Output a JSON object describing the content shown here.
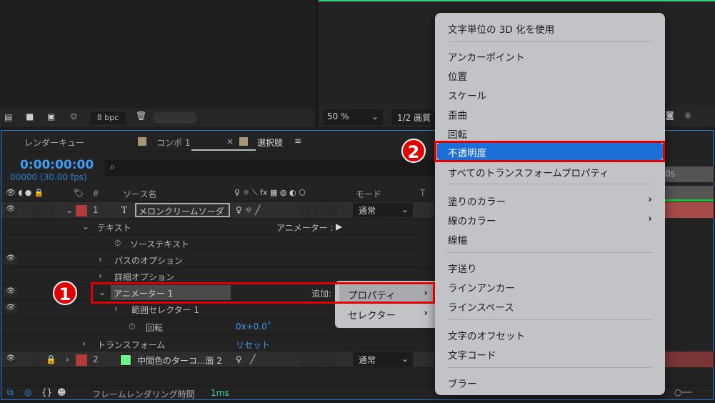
{
  "viewer_bar": {
    "bpc": "8 bpc",
    "zoom": "50 %",
    "quality": "1/2 画質"
  },
  "tabs": [
    {
      "label": "レンダーキュー"
    },
    {
      "label": "コンポ 1"
    },
    {
      "label": "選択肢",
      "close": "×",
      "active": true
    }
  ],
  "timecode": "0:00:00:00",
  "frames": "00000 (30.00 fps)",
  "columns": {
    "hash": "#",
    "source": "ソース名",
    "mode": "モード",
    "t": "T"
  },
  "layers": [
    {
      "num": "1",
      "type": "T",
      "name": "メロンクリームソーダ",
      "mode": "通常",
      "color": "#b23a3a"
    },
    {
      "num": "2",
      "name": "中間色のターコ...面 2",
      "mode": "通常",
      "color": "#b23a3a",
      "swatch": "#6ef08a"
    }
  ],
  "props": {
    "text": "テキスト",
    "animator_label": "アニメーター :",
    "source_text": "ソーステキスト",
    "path_options": "パスのオプション",
    "more_options": "詳細オプション",
    "animator": "アニメーター 1",
    "add": "追加:",
    "range_selector": "範囲セレクター 1",
    "rotation": "回転",
    "rotation_value": "0x+0.0˚",
    "transform": "トランスフォーム",
    "reset": "リセット"
  },
  "submenu": [
    "プロパティ",
    "セレクター"
  ],
  "status": {
    "label": "フレームレンダリング時間",
    "value": "1ms"
  },
  "timeline": {
    "ruler": "0s"
  },
  "menu": {
    "items": [
      "文字単位の 3D 化を使用",
      "アンカーポイント",
      "位置",
      "スケール",
      "歪曲",
      "回転",
      "不透明度",
      "すべてのトランスフォームプロパティ",
      "塗りのカラー",
      "線のカラー",
      "線幅",
      "字送り",
      "ラインアンカー",
      "ラインスペース",
      "文字のオフセット",
      "文字コード",
      "ブラー"
    ],
    "selected": "不透明度"
  },
  "badges": [
    "1",
    "2"
  ]
}
